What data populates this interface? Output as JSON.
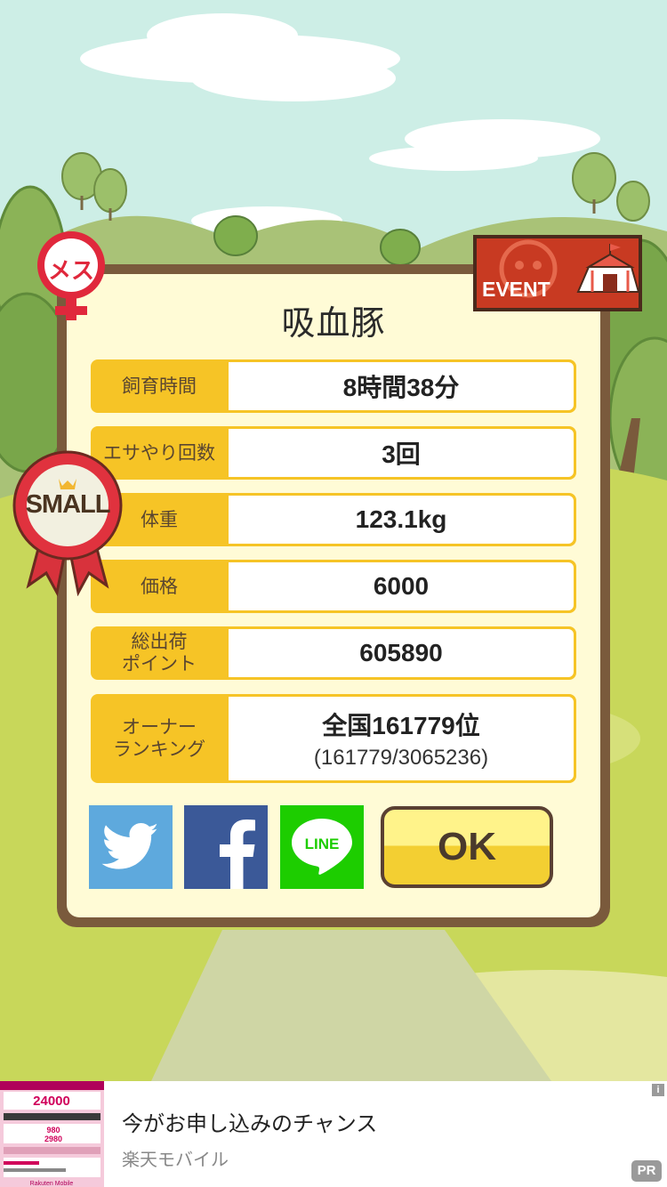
{
  "pig": {
    "name": "吸血豚",
    "gender_badge": "メス",
    "size_badge": "SMALL",
    "event_badge": "EVENT"
  },
  "stats": [
    {
      "label": "飼育時間",
      "value": "8時間38分"
    },
    {
      "label": "エサやり回数",
      "value": "3回"
    },
    {
      "label": "体重",
      "value": "123.1kg"
    },
    {
      "label": "価格",
      "value": "6000"
    },
    {
      "label": "総出荷\nポイント",
      "value": "605890"
    },
    {
      "label": "オーナー\nランキング",
      "value": "全国161779位",
      "sub": "(161779/3065236)"
    }
  ],
  "share": {
    "twitter_icon": "twitter-bird-icon",
    "facebook_icon": "facebook-f-icon",
    "line_label": "LINE"
  },
  "ok_label": "OK",
  "ad": {
    "title": "今がお申し込みのチャンス",
    "sponsor": "楽天モバイル",
    "pr_label": "PR",
    "info_label": "i",
    "thumb": {
      "headline": "24000",
      "price_a": "980",
      "price_b": "2980",
      "brand": "Rakuten Mobile"
    }
  },
  "colors": {
    "frame": "#7a5a3c",
    "panel": "#fffbd6",
    "label_bg": "#f6c426",
    "twitter": "#5ea9dd",
    "facebook": "#3b5998",
    "line": "#1dcd00",
    "ok_top": "#fff38a",
    "ok_bottom": "#f3cf32"
  }
}
